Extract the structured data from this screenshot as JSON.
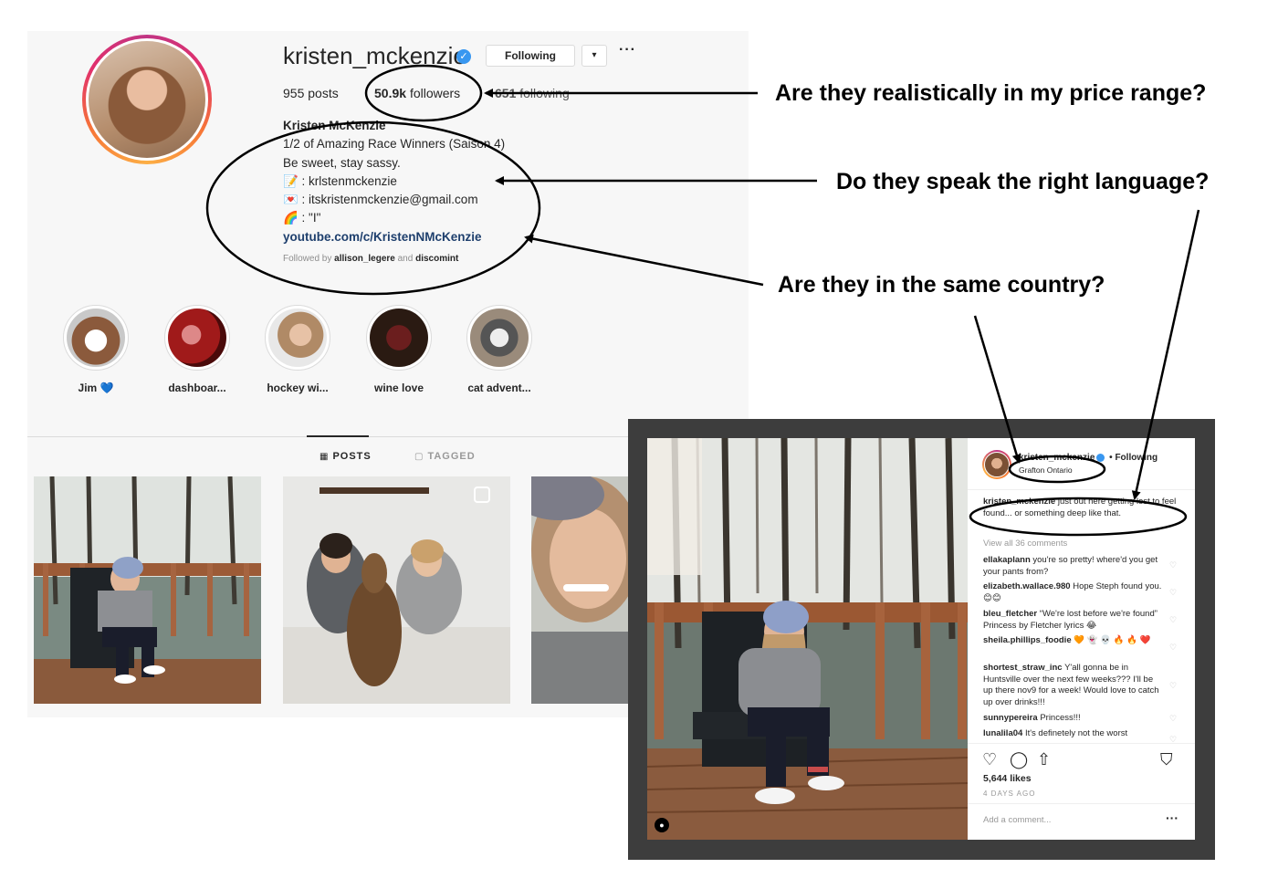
{
  "profile": {
    "username": "kristen_mckenzie",
    "verified_icon": "check-badge-icon",
    "following_button": "Following",
    "dropdown_glyph": "▾",
    "more_glyph": "···",
    "posts_count": "955",
    "posts_label": "posts",
    "followers_count": "50.9k",
    "followers_label": "followers",
    "following_count": "651",
    "following_label": "following",
    "bio": {
      "name": "Kristen McKenzie",
      "line1": "1/2 of Amazing Race Winners (Saison 4)",
      "line2": "Be sweet, stay sassy.",
      "line3": "📝 : krlstenmckenzie",
      "line4": "💌 : itskristenmckenzie@gmail.com",
      "line5": "🌈 : \"I\"",
      "link": "youtube.com/c/KristenNMcKenzie",
      "followed_by_prefix": "Followed by",
      "followed_user1": "allison_legere",
      "followed_and": "and",
      "followed_user2": "discomint"
    },
    "highlights": [
      {
        "label": "Jim 💙"
      },
      {
        "label": "dashboar..."
      },
      {
        "label": "hockey wi..."
      },
      {
        "label": "wine love"
      },
      {
        "label": "cat advent..."
      }
    ],
    "tabs": {
      "posts": "POSTS",
      "tagged": "TAGGED"
    }
  },
  "post": {
    "username": "kristen_mckenzie",
    "follow_status": "• Following",
    "location": "Grafton Ontario",
    "caption_user": "kristen_mckenzie",
    "caption_text": "just out here getting lost to feel found... or something deep like that.",
    "view_all": "View all 36 comments",
    "comments": [
      {
        "user": "ellakaplann",
        "text": "you're so pretty! where'd you get your pants from?"
      },
      {
        "user": "elizabeth.wallace.980",
        "text": "Hope Steph found you.😊😊"
      },
      {
        "user": "bleu_fletcher",
        "text": "“We're lost before we're found” Princess by Fletcher lyrics 😂"
      },
      {
        "user": "sheila.phillips_foodie",
        "text": "🧡 👻 💀 🔥 🔥 ❤️"
      },
      {
        "user": "shortest_straw_inc",
        "text": "Y'all gonna be in Huntsville over the next few weeks??? I'll be up there nov9 for a week! Would love to catch up over drinks!!!"
      },
      {
        "user": "sunnypereira",
        "text": "Princess!!!"
      },
      {
        "user": "lunalila04",
        "text": "It's definetely not the worst"
      }
    ],
    "likes": "5,644 likes",
    "time_ago": "4 DAYS AGO",
    "add_comment_placeholder": "Add a comment...",
    "more_glyph": "···"
  },
  "annotations": {
    "q1": "Are they realistically in my price range?",
    "q2": "Do they speak the right language?",
    "q3": "Are they in the same country?"
  }
}
